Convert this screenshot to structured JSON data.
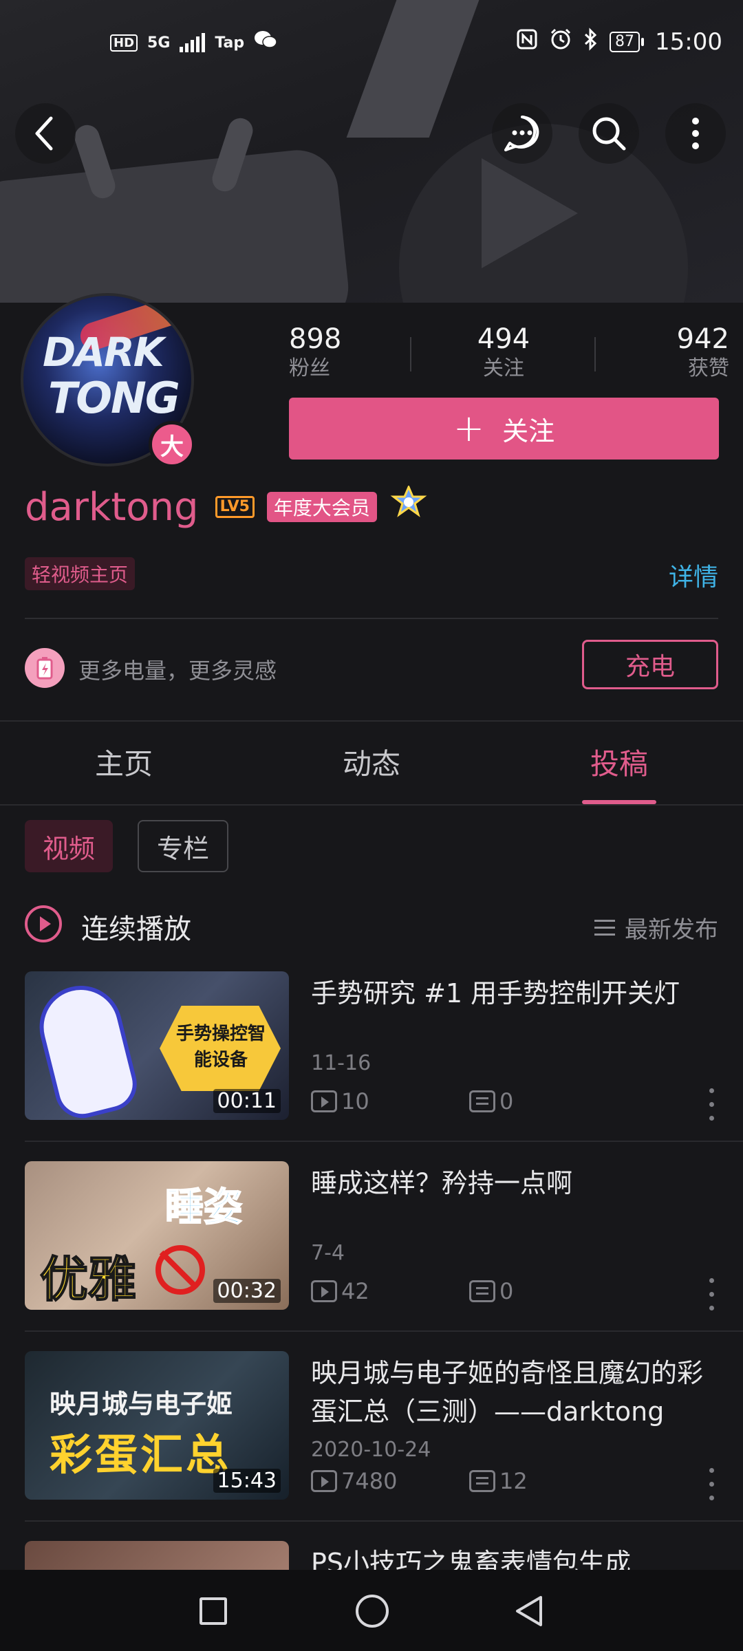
{
  "status_bar": {
    "left_labels": [
      "HD",
      "5G",
      "Tap"
    ],
    "battery": "87",
    "time": "15:00"
  },
  "header": {
    "icons": [
      "back-icon",
      "chat-icon",
      "search-icon",
      "more-icon"
    ]
  },
  "profile": {
    "avatar_text_line1": "DARK",
    "avatar_text_line2": "TONG",
    "avatar_badge": "大",
    "stats": [
      {
        "value": "898",
        "label": "粉丝"
      },
      {
        "value": "494",
        "label": "关注"
      },
      {
        "value": "942",
        "label": "获赞"
      }
    ],
    "follow_label": "关注",
    "username": "darktong",
    "level_badge": "LV5",
    "vip_label": "年度大会员",
    "light_video_tag": "轻视频主页",
    "detail_link": "详情",
    "charge_text": "更多电量，更多灵感",
    "charge_button": "充电"
  },
  "tabs": [
    {
      "label": "主页",
      "active": false
    },
    {
      "label": "动态",
      "active": false
    },
    {
      "label": "投稿",
      "active": true
    }
  ],
  "subtabs": [
    {
      "label": "视频",
      "active": true
    },
    {
      "label": "专栏",
      "active": false
    }
  ],
  "play_row": {
    "label": "连续播放",
    "sort_label": "最新发布"
  },
  "videos": [
    {
      "title": "手势研究  #1 用手势控制开关灯",
      "thumb_text": "手势操控智能设备",
      "duration": "00:11",
      "date": "11-16",
      "views": "10",
      "comments": "0"
    },
    {
      "title": "睡成这样？矜持一点啊",
      "thumb_text_1": "睡姿",
      "thumb_text_2": "优雅",
      "duration": "00:32",
      "date": "7-4",
      "views": "42",
      "comments": "0"
    },
    {
      "title": "映月城与电子姬的奇怪且魔幻的彩蛋汇总（三测）——darktong",
      "thumb_text_1": "映月城与电子姬",
      "thumb_text_2": "彩蛋汇总",
      "duration": "15:43",
      "date": "2020-10-24",
      "views": "7480",
      "comments": "12"
    },
    {
      "title": "PS小技巧之鬼畜表情包生成"
    }
  ],
  "navbar": {
    "icons": [
      "recent-apps-icon",
      "home-icon",
      "back-nav-icon"
    ]
  },
  "colors": {
    "accent": "#e05c8c",
    "follow_bg": "#e25586",
    "link": "#3fb3e6",
    "background": "#17171a"
  }
}
